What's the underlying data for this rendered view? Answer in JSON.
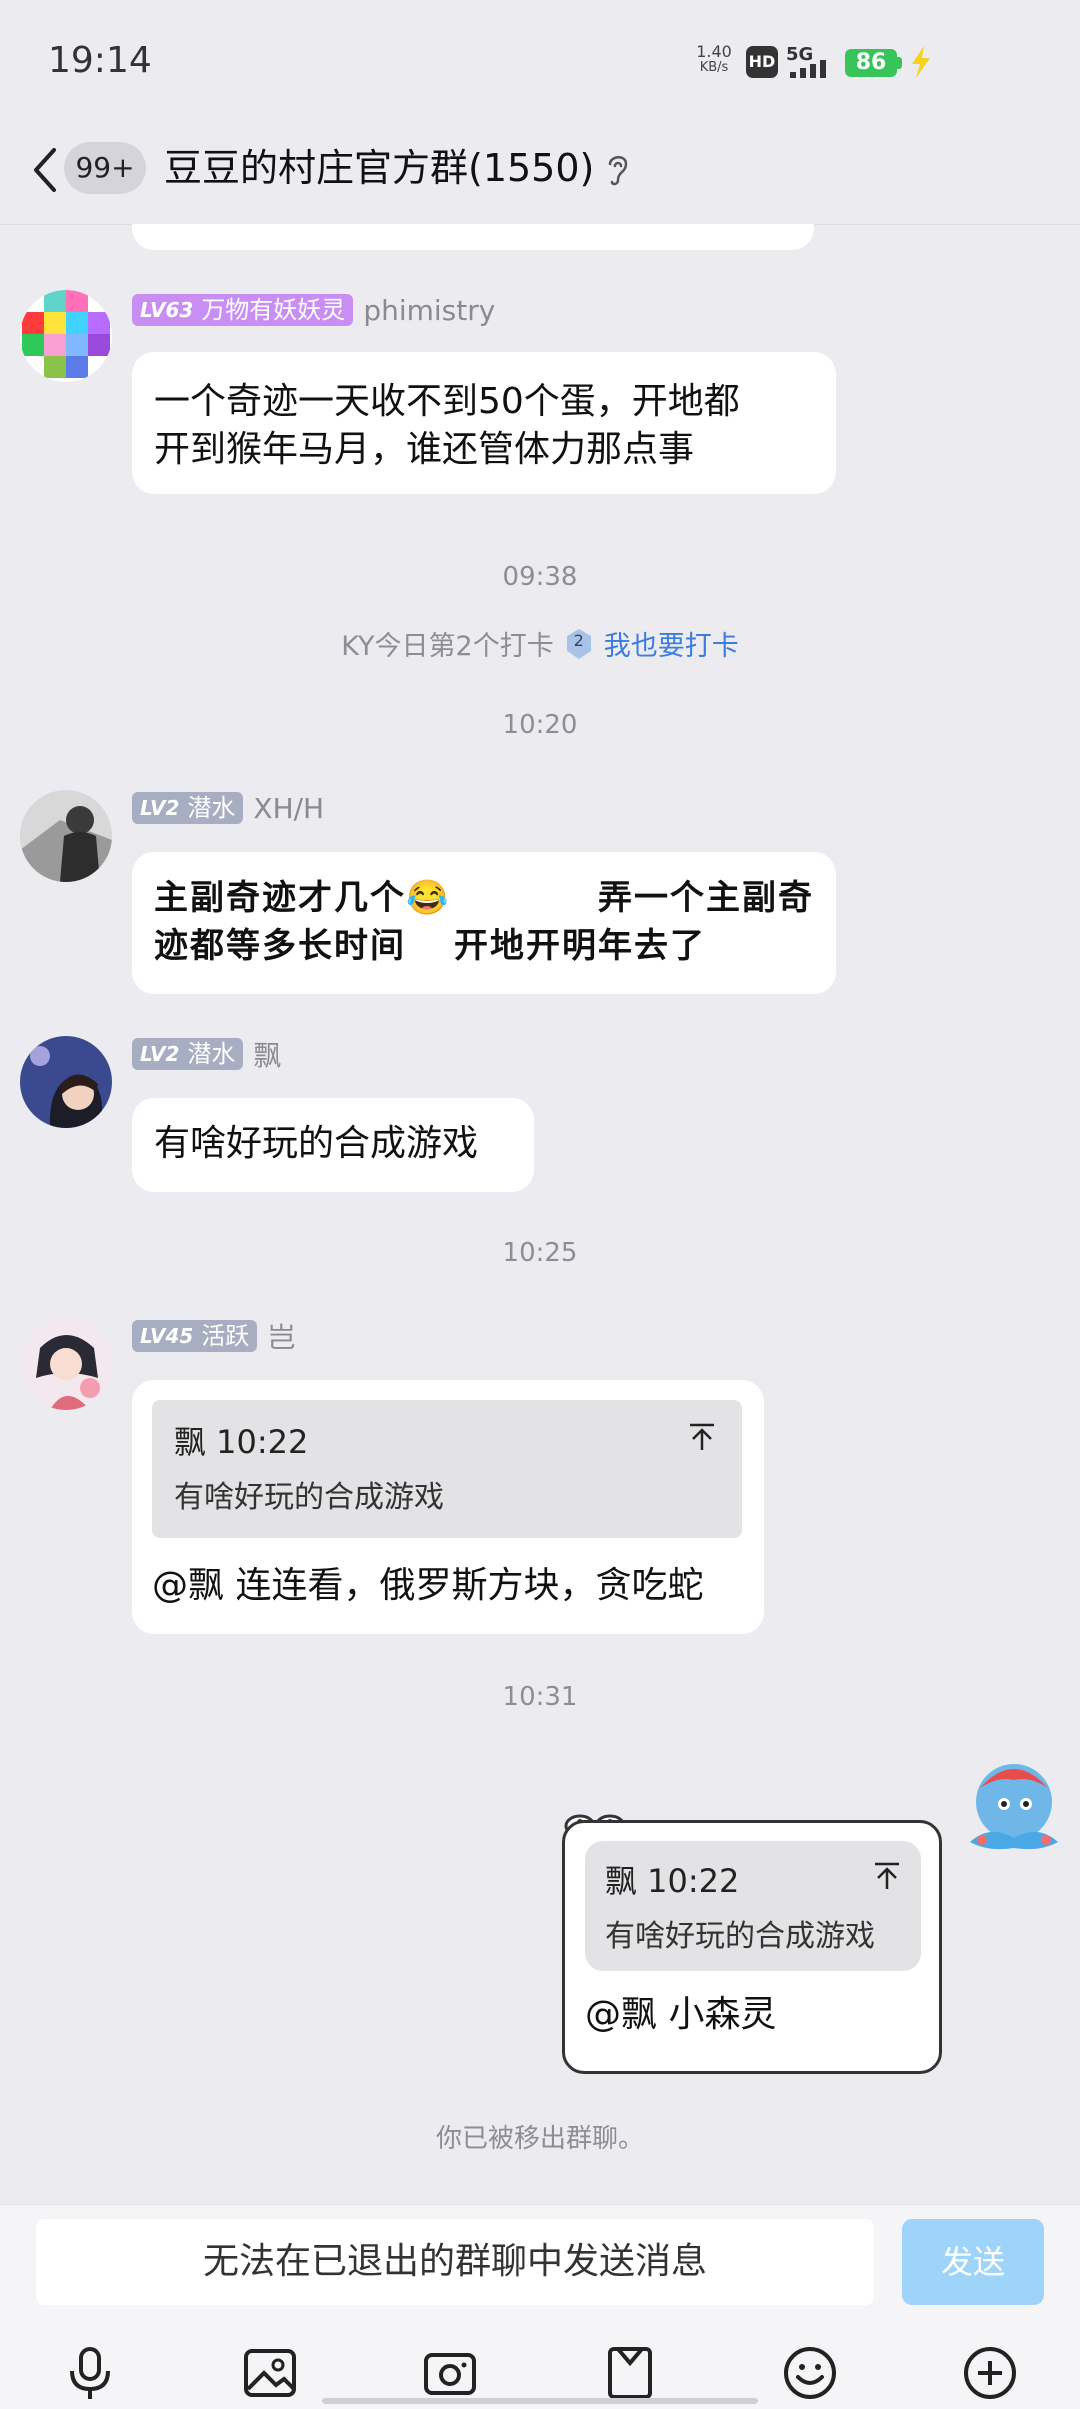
{
  "status_bar": {
    "time": "19:14",
    "net_speed": "1.40",
    "net_unit": "KB/s",
    "hd": "HD",
    "network": "5G",
    "battery": "86"
  },
  "header": {
    "unread": "99+",
    "title": "豆豆的村庄官方群(1550)"
  },
  "messages": [
    {
      "level": "LV63",
      "title": "万物有妖妖灵",
      "nickname": "phimistry",
      "text_line1": "一个奇迹一天收不到50个蛋，开地都",
      "text_line2": "开到猴年马月，谁还管体力那点事"
    },
    {
      "time": "09:38"
    },
    {
      "notice": "KY今日第2个打卡",
      "notice_badge": "2",
      "notice_link": "我也要打卡"
    },
    {
      "time": "10:20"
    },
    {
      "level": "LV2",
      "title": "潜水",
      "nickname": "XH/H",
      "text_line1a": "主副奇迹才几个",
      "emoji": "😂",
      "text_line1b": "弄一个主副奇",
      "text_line2a": "迹都等多长时间",
      "text_line2b": "开地开明年去了"
    },
    {
      "level": "LV2",
      "title": "潜水",
      "nickname": "飘",
      "text": "有啥好玩的合成游戏"
    },
    {
      "time": "10:25"
    },
    {
      "level": "LV45",
      "title": "活跃",
      "nickname": "岂",
      "quote_author_time": "飘 10:22",
      "quote_text": "有啥好玩的合成游戏",
      "text": "@飘 连连看，俄罗斯方块，贪吃蛇"
    },
    {
      "time": "10:31"
    },
    {
      "self": true,
      "quote_author_time": "飘 10:22",
      "quote_text": "有啥好玩的合成游戏",
      "text": "@飘 小森灵"
    },
    {
      "system": "你已被移出群聊。"
    }
  ],
  "input": {
    "placeholder": "无法在已退出的群聊中发送消息",
    "send": "发送"
  },
  "toolbar": [
    "mic-icon",
    "image-icon",
    "camera-icon",
    "file-icon",
    "emoji-icon",
    "add-icon"
  ],
  "colors": {
    "background": "#ebebf0",
    "badge_high_level": "#c98ef3",
    "badge_low_level": "#a8aec1",
    "link": "#3b7ddd",
    "send_disabled": "#9fd4fa"
  }
}
